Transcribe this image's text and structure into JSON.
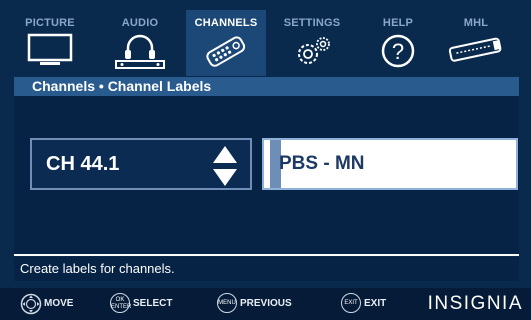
{
  "menu": {
    "tabs": [
      {
        "label": "PICTURE",
        "icon": "tv-icon",
        "active": false
      },
      {
        "label": "AUDIO",
        "icon": "headphones-speaker-icon",
        "active": false
      },
      {
        "label": "CHANNELS",
        "icon": "remote-control-icon",
        "active": true
      },
      {
        "label": "SETTINGS",
        "icon": "gears-icon",
        "active": false
      },
      {
        "label": "HELP",
        "icon": "question-icon",
        "active": false
      },
      {
        "label": "MHL",
        "icon": "mhl-cable-icon",
        "active": false
      }
    ]
  },
  "breadcrumb": "Channels • Channel Labels",
  "channel": {
    "value": "CH  44.1"
  },
  "label_field": {
    "cursor_char": "P",
    "value": "PBS - MN"
  },
  "hint": "Create labels for channels.",
  "footer": {
    "move": "MOVE",
    "select": "SELECT",
    "select_key_top": "OK",
    "select_key_bottom": "ENTER",
    "previous": "PREVIOUS",
    "previous_key": "MENU",
    "exit": "EXIT",
    "exit_key": "EXIT",
    "brand": "INSIGNIA"
  },
  "colors": {
    "background": "#0a2a4d",
    "active_tab": "#1c4878",
    "title_bar": "#2a5b8f"
  }
}
